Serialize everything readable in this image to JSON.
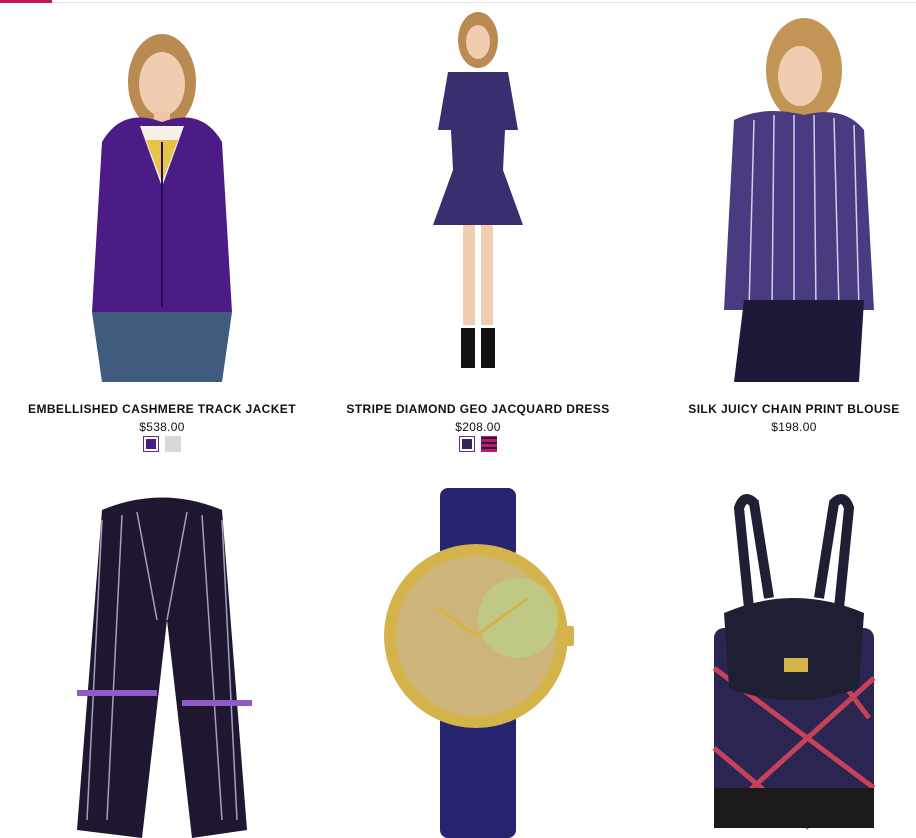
{
  "products": [
    {
      "name": "EMBELLISHED CASHMERE TRACK JACKET",
      "price": "$538.00",
      "swatches": [
        "#4b1c86",
        "#d8d8d8"
      ]
    },
    {
      "name": "STRIPE DIAMOND GEO JACQUARD DRESS",
      "price": "$208.00",
      "swatches": [
        "#2d2a5a",
        "#c2186b"
      ]
    },
    {
      "name": "SILK JUICY CHAIN PRINT BLOUSE",
      "price": "$198.00",
      "swatches": []
    },
    {
      "name": "",
      "price": "",
      "swatches": []
    },
    {
      "name": "",
      "price": "",
      "swatches": []
    },
    {
      "name": "",
      "price": "",
      "swatches": []
    }
  ],
  "colors": {
    "accent": "#c2185b",
    "jacket": "#4b1c86",
    "dress": "#3a2e6e",
    "blouse": "#4a3a80",
    "scarf": "#1f1730",
    "watch_strap": "#26246e",
    "gold": "#d4b44a"
  }
}
